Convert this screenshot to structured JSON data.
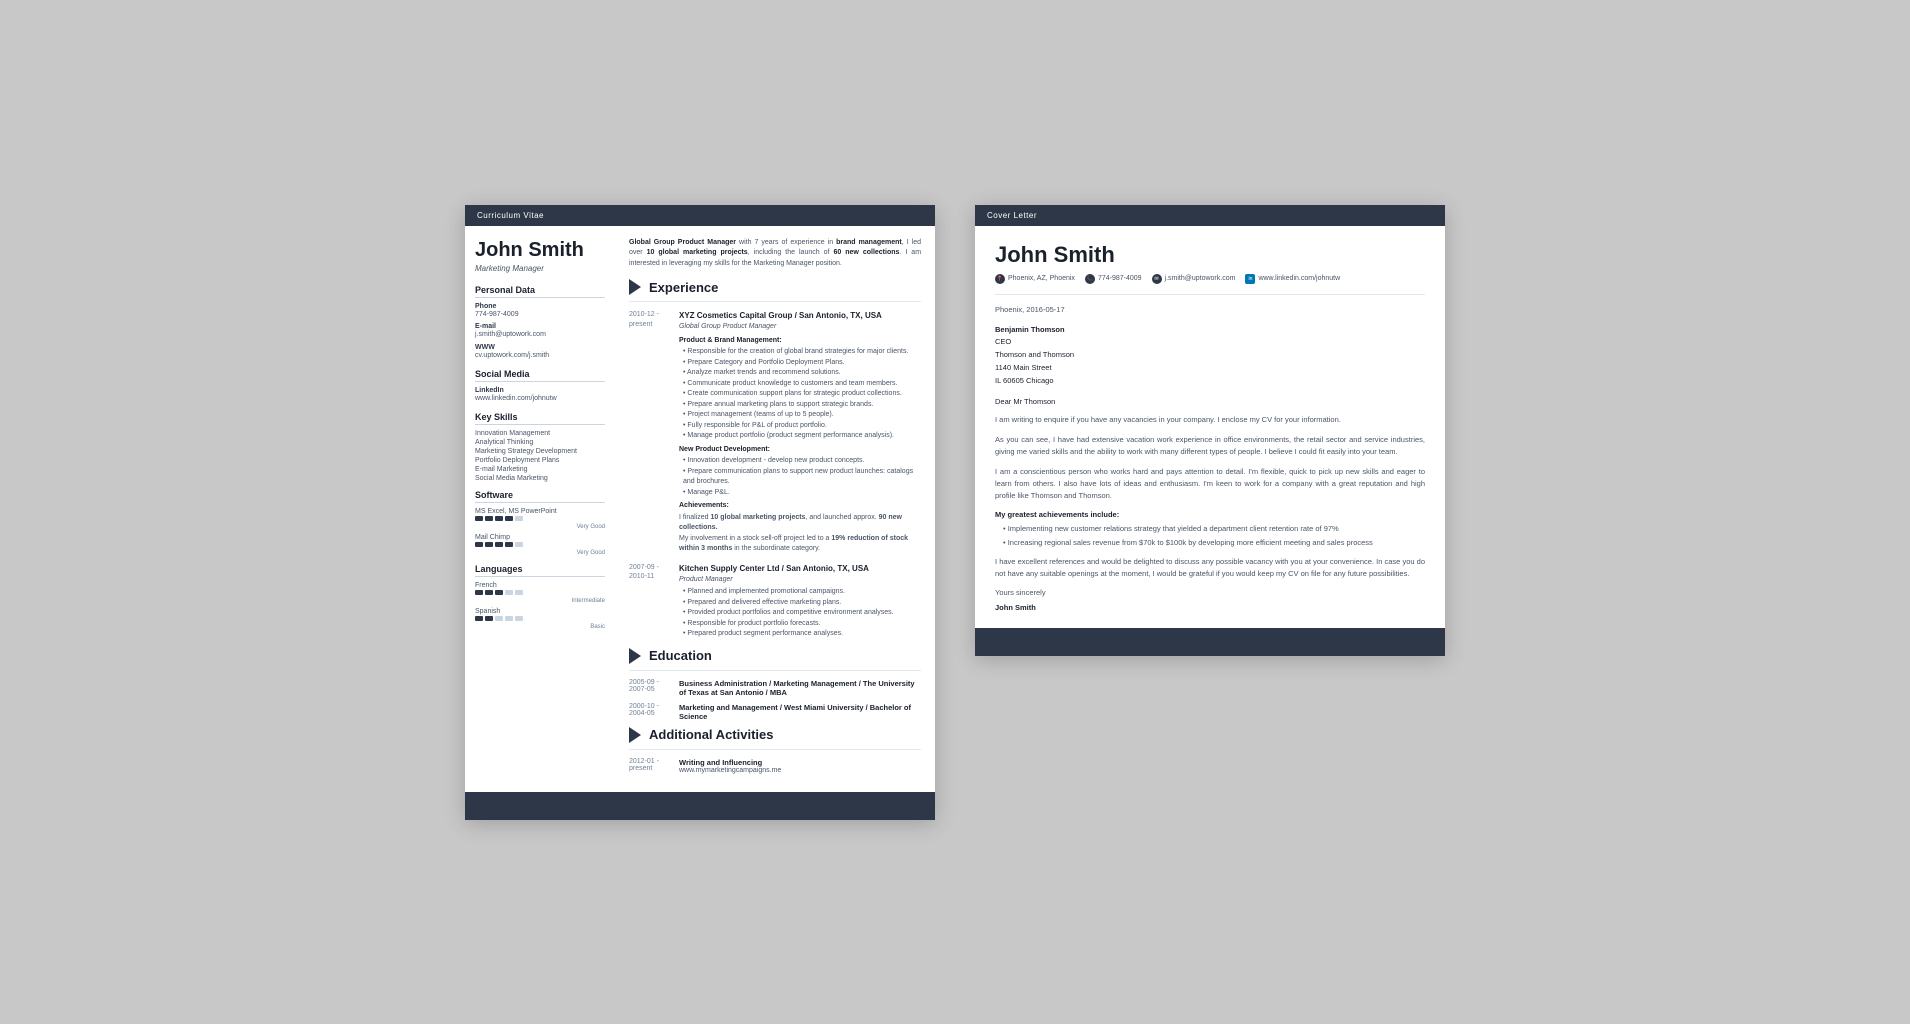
{
  "cv": {
    "header_bar": "Curriculum Vitae",
    "name": "John Smith",
    "title": "Marketing Manager",
    "summary": "Global Group Product Manager with 7 years of experience in brand management, I led over 10 global marketing projects, including the launch of 60 new collections. I am interested in leveraging my skills for the Marketing Manager position.",
    "sidebar": {
      "personal_data_title": "Personal Data",
      "phone_label": "Phone",
      "phone_value": "774-987-4009",
      "email_label": "E-mail",
      "email_value": "j.smith@uptowork.com",
      "www_label": "WWW",
      "www_value": "cv.uptowork.com/j.smith",
      "social_media_title": "Social Media",
      "linkedin_label": "LinkedIn",
      "linkedin_value": "www.linkedin.com/johnutw",
      "key_skills_title": "Key Skills",
      "skills": [
        "Innovation Management",
        "Analytical Thinking",
        "Marketing Strategy Development",
        "Portfolio Deployment Plans",
        "E-mail Marketing",
        "Social Media Marketing"
      ],
      "software_title": "Software",
      "software": [
        {
          "name": "MS Excel, MS PowerPoint",
          "rating": 4,
          "label": "Very Good"
        },
        {
          "name": "Mail Chimp",
          "rating": 4,
          "label": "Very Good"
        }
      ],
      "languages_title": "Languages",
      "languages": [
        {
          "name": "French",
          "rating": 3,
          "label": "Intermediate"
        },
        {
          "name": "Spanish",
          "rating": 2,
          "label": "Basic"
        }
      ]
    },
    "experience_section": "Experience",
    "experience": [
      {
        "date_start": "2010-12 -",
        "date_end": "present",
        "company": "XYZ Cosmetics Capital Group / San Antonio, TX, USA",
        "position": "Global Group Product Manager",
        "subsection_product": "Product & Brand Management:",
        "bullets_product": [
          "Responsible for the creation of global brand strategies for major clients.",
          "Prepare Category and Portfolio Deployment Plans.",
          "Analyze market trends and recommend solutions.",
          "Communicate product knowledge to customers and team members.",
          "Create communication support plans for strategic product collections.",
          "Prepare annual marketing plans to support strategic brands.",
          "Project management (teams of up to 5 people).",
          "Fully responsible for P&L of product portfolio.",
          "Manage product portfolio (product segment performance analysis)."
        ],
        "subsection_new": "New Product Development:",
        "bullets_new": [
          "Innovation development - develop new product concepts.",
          "Prepare communication plans to support new product launches: catalogs and brochures.",
          "Manage P&L."
        ],
        "subsection_achievements": "Achievements:",
        "achievements_text": "I finalized 10 global marketing projects, and launched approx. 90 new collections.\nMy involvement in a stock sell-off project led to a 19% reduction of stock within 3 months in the subordinate category."
      },
      {
        "date_start": "2007-09 -",
        "date_end": "2010-11",
        "company": "Kitchen Supply Center Ltd / San Antonio, TX, USA",
        "position": "Product Manager",
        "bullets": [
          "Planned and implemented promotional campaigns.",
          "Prepared and delivered effective marketing plans.",
          "Provided product portfolios and competitive environment analyses.",
          "Responsible for product portfolio forecasts.",
          "Prepared product segment performance analyses."
        ]
      }
    ],
    "education_section": "Education",
    "education": [
      {
        "date_start": "2005-09 -",
        "date_end": "2007-05",
        "school": "Business Administration / Marketing Management / The University of Texas at San Antonio / MBA"
      },
      {
        "date_start": "2000-10 -",
        "date_end": "2004-05",
        "school": "Marketing and Management / West Miami University / Bachelor of Science"
      }
    ],
    "activities_section": "Additional Activities",
    "activities": [
      {
        "date_start": "2012-01 -",
        "date_end": "present",
        "title": "Writing and Influencing",
        "url": "www.mymarketingcampaigns.me"
      }
    ]
  },
  "cover_letter": {
    "header_bar": "Cover Letter",
    "name": "John Smith",
    "contact": {
      "location": "Phoenix, AZ, Phoenix",
      "phone": "774-987-4009",
      "email": "j.smith@uptowork.com",
      "linkedin": "www.linkedin.com/johnutw"
    },
    "date": "Phoenix, 2016-05-17",
    "recipient": {
      "name": "Benjamin Thomson",
      "title": "CEO",
      "company": "Thomson and Thomson",
      "address": "1140 Main Street",
      "city": "IL 60605 Chicago"
    },
    "greeting": "Dear Mr Thomson",
    "paragraphs": [
      "I am writing to enquire if you have any vacancies in your company. I enclose my CV for your information.",
      "As you can see, I have had extensive vacation work experience in office environments, the retail sector and service industries, giving me varied skills and the ability to work with many different types of people. I believe I could fit easily into your team.",
      "I am a conscientious person who works hard and pays attention to detail. I'm flexible, quick to pick up new skills and eager to learn from others. I also have lots of ideas and enthusiasm. I'm keen to work for a company with a great reputation and high profile like Thomson and Thomson."
    ],
    "achievements_title": "My greatest achievements include:",
    "achievements": [
      "Implementing new customer relations strategy that yielded a department client retention rate of 97%",
      "Increasing regional sales revenue from $70k to $100k by developing more efficient meeting and sales process"
    ],
    "closing_paragraph": "I have excellent references and would be delighted to discuss any possible vacancy with you at your convenience. In case you do not have any suitable openings at the moment, I would be grateful if you would keep my CV on file for any future possibilities.",
    "valediction": "Yours sincerely",
    "signature": "John Smith"
  }
}
